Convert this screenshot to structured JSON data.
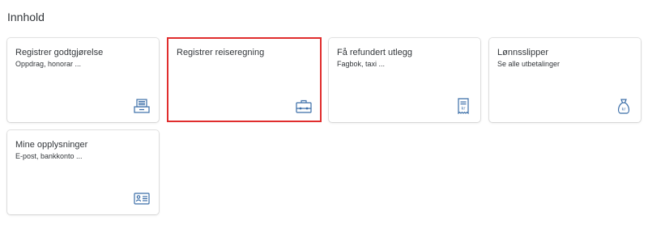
{
  "section": {
    "title": "Innhold"
  },
  "tiles": [
    {
      "title": "Registrer godtgjørelse",
      "subtitle": "Oppdrag, honorar ...",
      "icon": "form-tray-icon"
    },
    {
      "title": "Registrer reiseregning",
      "subtitle": "",
      "icon": "briefcase-icon"
    },
    {
      "title": "Få refundert utlegg",
      "subtitle": "Fagbok, taxi ...",
      "icon": "receipt-icon"
    },
    {
      "title": "Lønnsslipper",
      "subtitle": "Se alle utbetalinger",
      "icon": "money-bag-icon"
    },
    {
      "title": "Mine opplysninger",
      "subtitle": "E-post, bankkonto ...",
      "icon": "id-card-icon"
    }
  ],
  "colors": {
    "icon": "#3b6ea8",
    "selected_border": "#e02d2d",
    "text": "#32363a"
  }
}
